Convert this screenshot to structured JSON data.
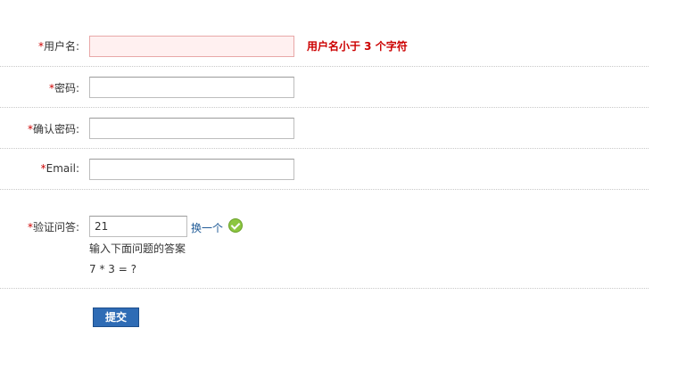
{
  "required_marker": "*",
  "fields": {
    "username": {
      "label": "用户名:",
      "value": "",
      "error": "用户名小于  3 个字符"
    },
    "password": {
      "label": "密码:",
      "value": ""
    },
    "confirm_password": {
      "label": "确认密码:",
      "value": ""
    },
    "email": {
      "label": "Email:",
      "value": ""
    },
    "captcha": {
      "label": "验证问答:",
      "value": "21",
      "refresh_link": "换一个",
      "hint": "输入下面问题的答案",
      "question": "7 * 3 = ?",
      "status_icon": "check-circle-icon"
    }
  },
  "submit_label": "提交",
  "colors": {
    "required": "#cc0000",
    "error_text": "#cc0000",
    "link": "#1e5a96",
    "button": "#2f6cb5",
    "success": "#8cc63f"
  }
}
